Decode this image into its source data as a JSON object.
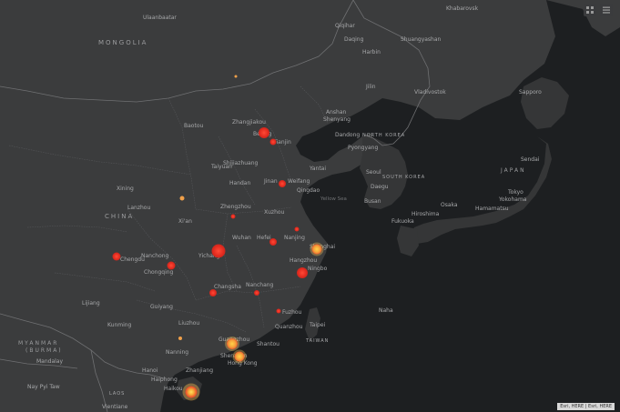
{
  "map": {
    "labels": {
      "ulaanbaatar": "Ulaanbaatar",
      "mongolia": "MONGOLIA",
      "khabarovsk": "Khabarovsk",
      "qiqihar": "Qiqihar",
      "daqing": "Daqing",
      "shuangyashan": "Shuangyashan",
      "harbin": "Harbin",
      "jilin": "Jilin",
      "vladivostok": "Vladivostok",
      "sapporo": "Sapporo",
      "baotou": "Baotou",
      "zhangjiakou": "Zhangjiakou",
      "beijing": "Beijing",
      "tianjin": "Tianjin",
      "anshan": "Anshan",
      "shenyang": "Shenyang",
      "dandong": "Dandong",
      "pyongyang": "Pyongyang",
      "north_korea": "NORTH KOREA",
      "seoul": "Seoul",
      "south_korea": "SOUTH KOREA",
      "daegu": "Daegu",
      "busan": "Busan",
      "japan": "JAPAN",
      "sendai": "Sendai",
      "tokyo": "Tokyo",
      "yokohama": "Yokohama",
      "hamamatsu": "Hamamatsu",
      "osaka": "Osaka",
      "hiroshima": "Hiroshima",
      "fukuoka": "Fukuoka",
      "shijiazhuang": "Shijiazhuang",
      "taiyuan": "Taiyuan",
      "yantai": "Yantai",
      "jinan": "Jinan",
      "weifang": "Weifang",
      "qingdao": "Qingdao",
      "yellow_sea": "Yellow Sea",
      "handan": "Handan",
      "xining": "Xining",
      "lanzhou": "Lanzhou",
      "china": "CHINA",
      "zhengzhou": "Zhengzhou",
      "xian": "Xi'an",
      "xuzhou": "Xuzhou",
      "nanjing": "Nanjing",
      "hefei": "Hefei",
      "shanghai": "Shanghai",
      "wuhan": "Wuhan",
      "hangzhou": "Hangzhou",
      "ningbo": "Ningbo",
      "nanchong": "Nanchong",
      "chengdu": "Chengdu",
      "chongqing": "Chongqing",
      "yichang": "Yichang",
      "changsha": "Changsha",
      "nanchang": "Nanchang",
      "guiyang": "Guiyang",
      "fuzhou": "Fuzhou",
      "quanzhou": "Quanzhou",
      "taipei": "Taipei",
      "taiwan": "TAIWAN",
      "naha": "Naha",
      "kunming": "Kunming",
      "lijiang": "Lijiang",
      "liuzhou": "Liuzhou",
      "nanning": "Nanning",
      "guangzhou": "Guangzhou",
      "shantou": "Shantou",
      "shenzhen": "Shenzhen",
      "hong_kong": "Hong Kong",
      "myanmar": "MYANMAR",
      "burma": "(BURMA)",
      "mandalay": "Mandalay",
      "hanoi": "Hanoi",
      "haiphong": "Haiphong",
      "zhanjiang": "Zhanjiang",
      "laos": "LAOS",
      "nay_pyi_taw": "Nay Pyi Taw",
      "vientiane": "Vientiane",
      "haikou": "Haikou"
    },
    "attribution": "Esri, HERE | Esri, HERE"
  }
}
